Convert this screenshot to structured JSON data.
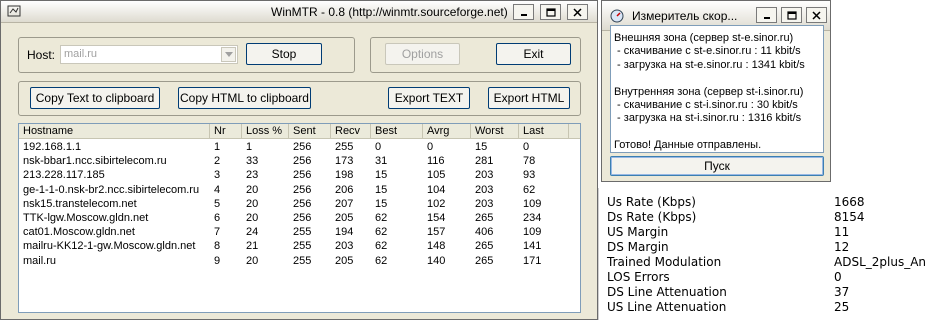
{
  "winmtr": {
    "title": "WinMTR - 0.8 (http://winmtr.sourceforge.net)",
    "host_label": "Host:",
    "host_value": "mail.ru",
    "stop_label": "Stop",
    "options_label": "Options",
    "exit_label": "Exit",
    "copy_text_label": "Copy Text to clipboard",
    "copy_html_label": "Copy HTML to clipboard",
    "export_text_label": "Export TEXT",
    "export_html_label": "Export HTML",
    "columns": [
      "Hostname",
      "Nr",
      "Loss %",
      "Sent",
      "Recv",
      "Best",
      "Avrg",
      "Worst",
      "Last"
    ],
    "rows": [
      [
        "192.168.1.1",
        "1",
        "1",
        "256",
        "255",
        "0",
        "0",
        "15",
        "0"
      ],
      [
        "nsk-bbar1.ncc.sibirtelecom.ru",
        "2",
        "33",
        "256",
        "173",
        "31",
        "116",
        "281",
        "78"
      ],
      [
        "213.228.117.185",
        "3",
        "23",
        "256",
        "198",
        "15",
        "105",
        "203",
        "93"
      ],
      [
        "ge-1-1-0.nsk-br2.ncc.sibirtelecom.ru",
        "4",
        "20",
        "256",
        "206",
        "15",
        "104",
        "203",
        "62"
      ],
      [
        "nsk15.transtelecom.net",
        "5",
        "20",
        "256",
        "207",
        "15",
        "102",
        "203",
        "109"
      ],
      [
        "TTK-lgw.Moscow.gldn.net",
        "6",
        "20",
        "256",
        "205",
        "62",
        "154",
        "265",
        "234"
      ],
      [
        "cat01.Moscow.gldn.net",
        "7",
        "24",
        "255",
        "194",
        "62",
        "157",
        "406",
        "109"
      ],
      [
        "mailru-KK12-1-gw.Moscow.gldn.net",
        "8",
        "21",
        "255",
        "203",
        "62",
        "148",
        "265",
        "141"
      ],
      [
        "mail.ru",
        "9",
        "20",
        "255",
        "205",
        "62",
        "140",
        "265",
        "171"
      ]
    ]
  },
  "speed": {
    "title": "Измеритель скор...",
    "lines": [
      "Внешняя зона (сервер st-e.sinor.ru)",
      " - скачивание с st-e.sinor.ru : 11 kbit/s",
      " - загрузка на st-e.sinor.ru : 1341 kbit/s",
      "",
      "Внутренняя зона (сервер st-i.sinor.ru)",
      " - скачивание с st-i.sinor.ru : 30 kbit/s",
      " - загрузка на st-i.sinor.ru : 1316 kbit/s",
      "",
      "Готово! Данные отправлены."
    ],
    "start_label": "Пуск"
  },
  "modem_stats": [
    {
      "label": "Us Rate (Kbps)",
      "value": "1668"
    },
    {
      "label": "Ds Rate (Kbps)",
      "value": "8154"
    },
    {
      "label": "US Margin",
      "value": "11"
    },
    {
      "label": "DS Margin",
      "value": "12"
    },
    {
      "label": "Trained Modulation",
      "value": "ADSL_2plus_An"
    },
    {
      "label": "LOS Errors",
      "value": "0"
    },
    {
      "label": "DS Line Attenuation",
      "value": "37"
    },
    {
      "label": "US Line Attenuation",
      "value": "25"
    }
  ]
}
